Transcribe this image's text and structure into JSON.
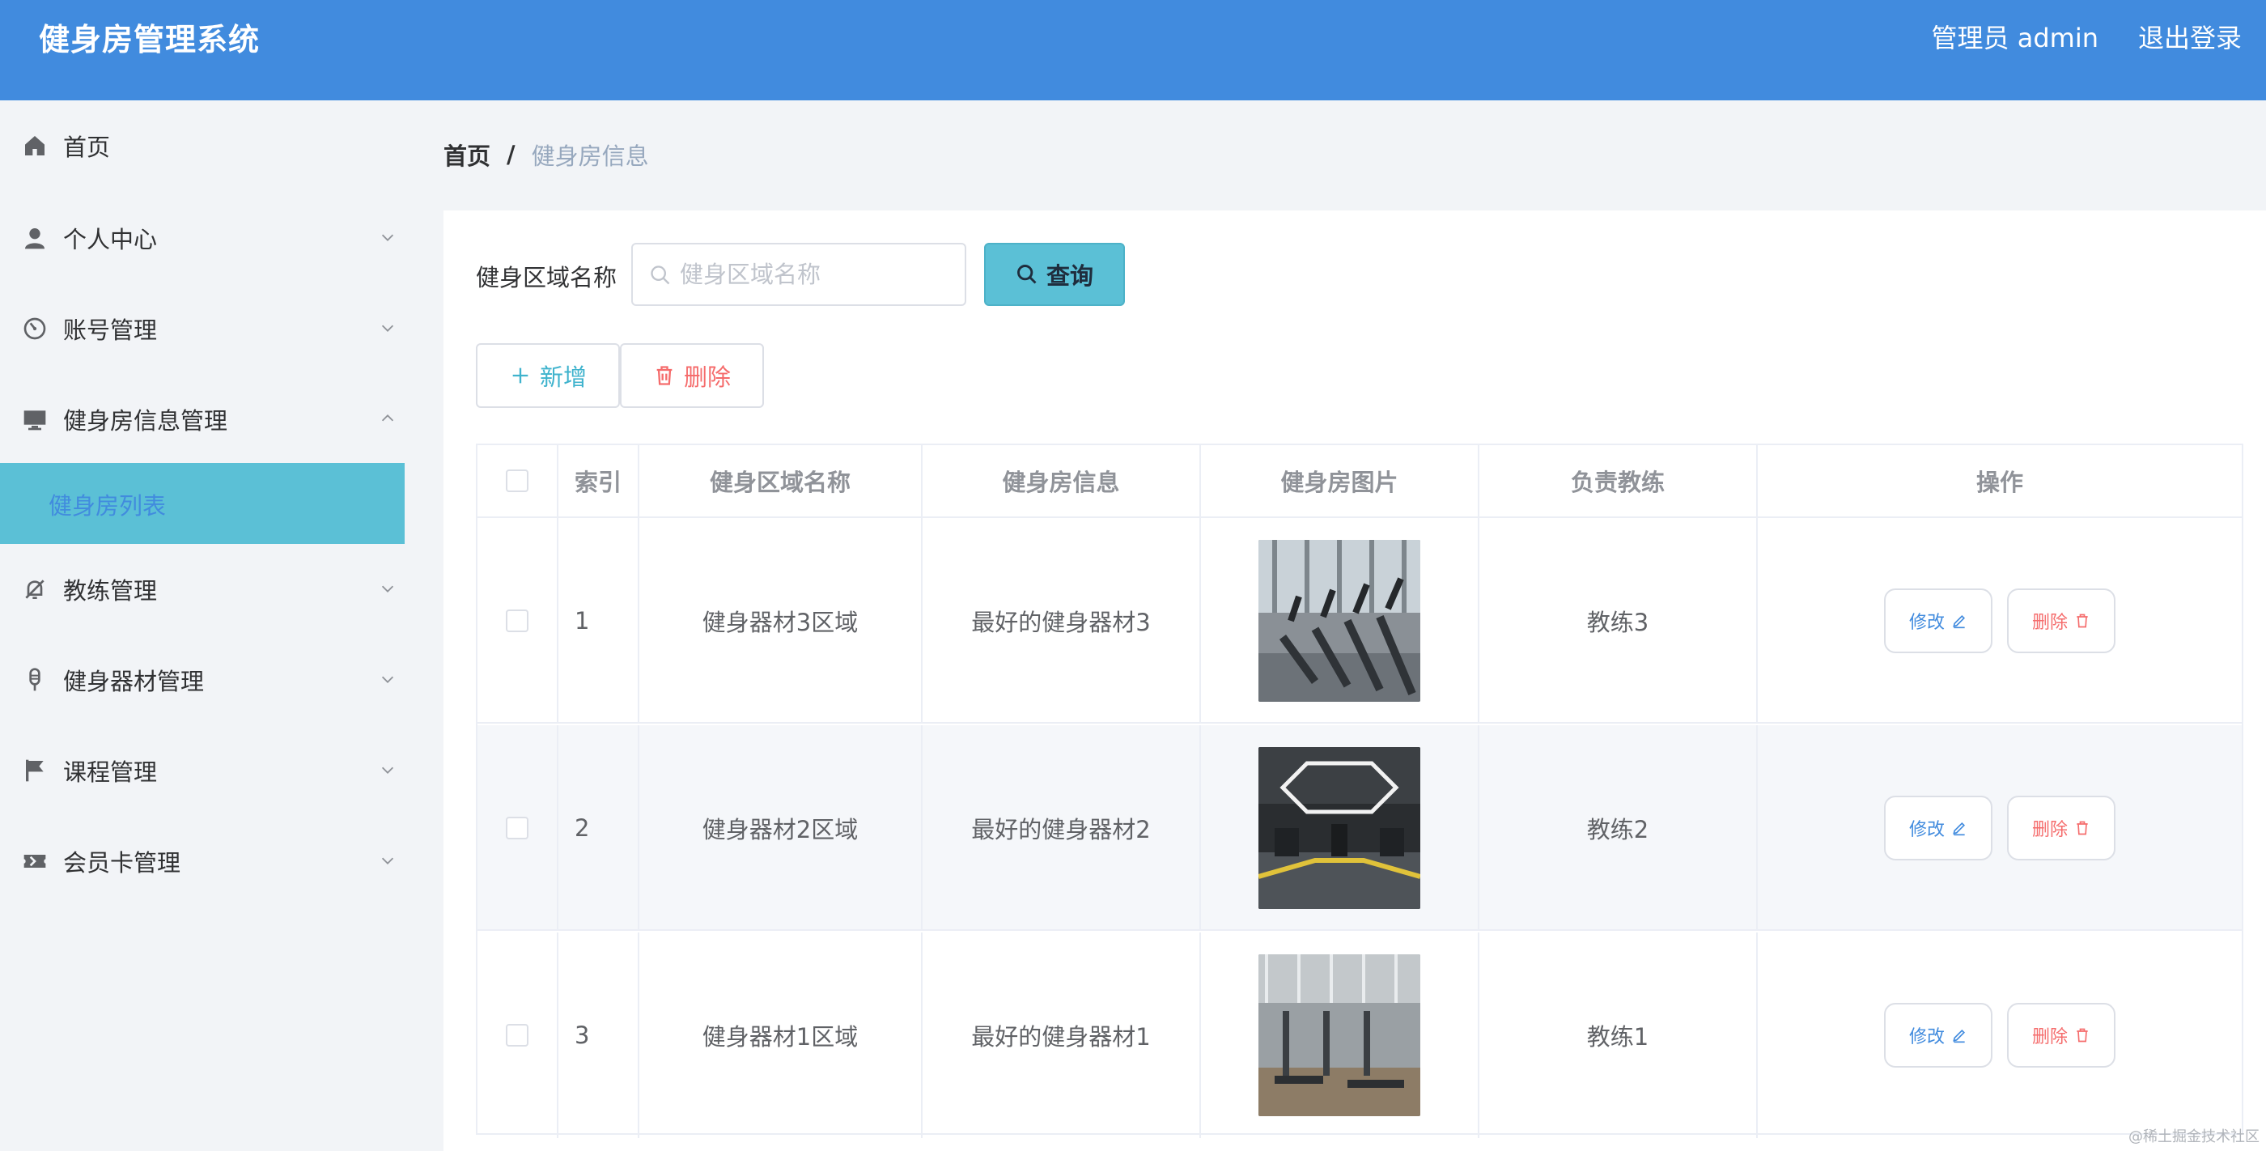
{
  "header": {
    "title": "健身房管理系统",
    "user": "管理员 admin",
    "logout": "退出登录"
  },
  "sidebar": {
    "items": [
      {
        "label": "首页",
        "icon": "home-icon"
      },
      {
        "label": "个人中心",
        "icon": "user-icon"
      },
      {
        "label": "账号管理",
        "icon": "dashboard-icon"
      },
      {
        "label": "健身房信息管理",
        "icon": "monitor-icon",
        "expanded": true
      },
      {
        "label": "教练管理",
        "icon": "bell-off-icon"
      },
      {
        "label": "健身器材管理",
        "icon": "microphone-icon"
      },
      {
        "label": "课程管理",
        "icon": "flag-icon"
      },
      {
        "label": "会员卡管理",
        "icon": "ticket-icon"
      }
    ],
    "active_sub": "健身房列表"
  },
  "breadcrumb": {
    "home": "首页",
    "sep": "/",
    "current": "健身房信息"
  },
  "search": {
    "label": "健身区域名称",
    "placeholder": "健身区域名称",
    "query_label": "查询"
  },
  "actions": {
    "add_label": "新增",
    "delete_label": "删除"
  },
  "table": {
    "headers": [
      "索引",
      "健身区域名称",
      "健身房信息",
      "健身房图片",
      "负责教练",
      "操作"
    ],
    "rows": [
      {
        "index": "1",
        "area": "健身器材3区域",
        "info": "最好的健身器材3",
        "coach": "教练3"
      },
      {
        "index": "2",
        "area": "健身器材2区域",
        "info": "最好的健身器材2",
        "coach": "教练2"
      },
      {
        "index": "3",
        "area": "健身器材1区域",
        "info": "最好的健身器材1",
        "coach": "教练1"
      }
    ],
    "edit_label": "修改",
    "remove_label": "删除"
  },
  "colors": {
    "header": "#418bde",
    "active": "#5bc0d6",
    "danger": "#f56c6c"
  },
  "watermark": "@稀土掘金技术社区"
}
